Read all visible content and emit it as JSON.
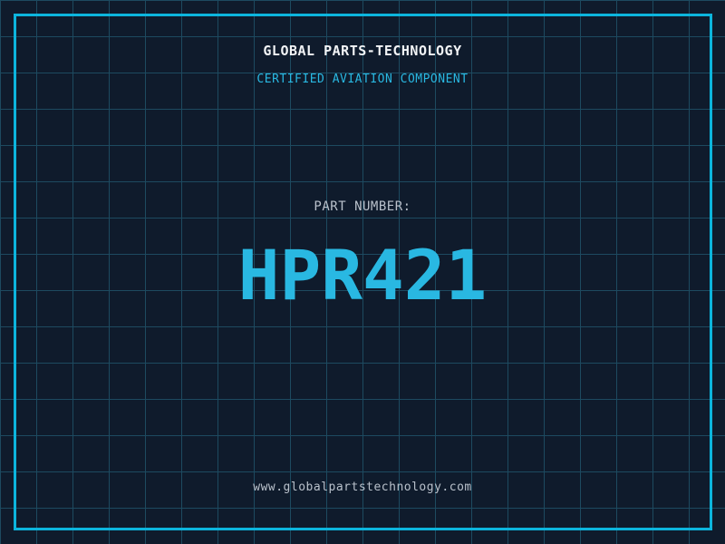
{
  "page": {
    "brand": "GLOBAL PARTS-TECHNOLOGY",
    "certification": "CERTIFIED AVIATION COMPONENT",
    "part_label": "PART NUMBER:",
    "part_number": "HPR421",
    "website": "www.globalpartstechnology.com"
  },
  "colors": {
    "background": "#0f1b2c",
    "grid_line": "#1d4a60",
    "frame_border": "#0cb5dd",
    "accent_cyan": "#29b8e2",
    "title_white": "#f2f4f6",
    "muted_gray": "#b9c1cb"
  }
}
